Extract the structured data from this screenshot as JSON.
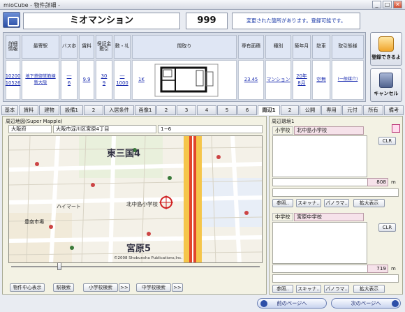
{
  "window": {
    "title": "mioCube - 物件詳細 -",
    "min": "_",
    "max": "□",
    "close": "✕"
  },
  "header": {
    "building_name": "ミオマンション",
    "number": "999",
    "message": "変更された箇所があります。登録可能です。"
  },
  "info": {
    "headers": [
      "詳細情報",
      "最寄駅",
      "バス歩",
      "賃料",
      "保証金敷引",
      "敷・礼",
      "間取り",
      "専有面積",
      "種別",
      "築年月",
      "駐車",
      "取引態様"
    ],
    "header_units": {
      "bus": "徒歩",
      "rent": "万円",
      "deposit": "万円",
      "area": "㎡"
    },
    "cells": {
      "detail": "10200\n10526",
      "station": "地下鉄御堂筋線\n新大阪",
      "bus": "―\n6",
      "rent": "9.9",
      "deposit": "30\n9",
      "shiki": "―\n1000",
      "madori": "1K",
      "area": "23.45",
      "type": "マンション",
      "built": "20年\n8月",
      "parking": "空無",
      "torihiki": "(一般媒介)"
    }
  },
  "side": {
    "register": "登録できるよ",
    "cancel": "キャンセル"
  },
  "tabs": [
    "基本",
    "賃料",
    "建物",
    "設備1",
    "2",
    "入居条件",
    "画像1",
    "2",
    "3",
    "4",
    "5",
    "6",
    "周辺1",
    "2",
    "公開",
    "専用",
    "元付",
    "所有",
    "備考"
  ],
  "active_tab": "周辺1",
  "map_panel": {
    "title": "周辺地図(Super Mapple)",
    "pref": "大阪府",
    "address": "大阪市淀川区宮原4丁目",
    "chome": "1−6",
    "map_labels": {
      "area1": "東三国4",
      "area2": "宮原5",
      "school": "北中島小学校",
      "shop": "ハイマート",
      "bank": "豊南市場",
      "copyright": "©2008 Shobunsha Publications,Inc."
    },
    "buttons": {
      "center": "物件中心表示",
      "station": "駅検索",
      "elem": "小学校検索",
      "elem_arrow": ">>",
      "jhs": "中学校検索",
      "jhs_arrow": ">>"
    }
  },
  "env_panel": {
    "title": "周辺環境1",
    "elem_label": "小学校",
    "elem_name": "北中島小学校",
    "elem_dist": "808",
    "unit": "m",
    "jhs_label": "中学校",
    "jhs_name": "宮原中学校",
    "jhs_dist": "719",
    "clr": "CLR",
    "ref": "参照..",
    "scan": "スキャナ..",
    "pano": "パノラマ..",
    "zoom": "拡大表示"
  },
  "nav": {
    "prev": "前のページへ",
    "next": "次のページへ"
  }
}
